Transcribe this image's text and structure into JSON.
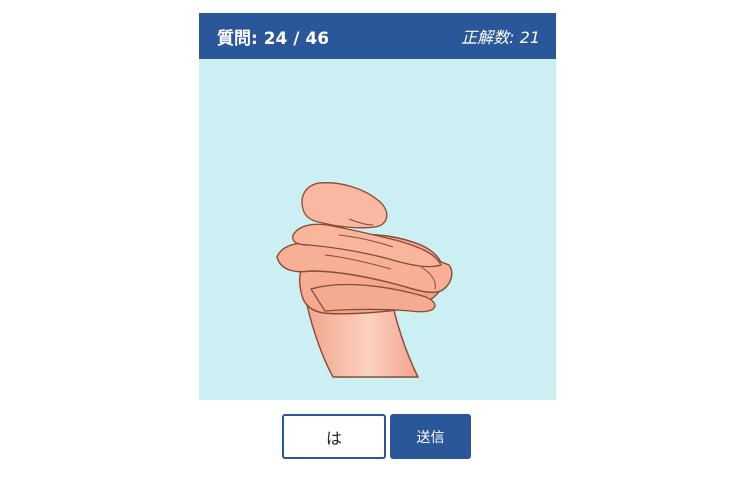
{
  "quiz": {
    "question_counter": "質問: 24 / 46",
    "correct_counter": "正解数: 21",
    "image_subject": "hand-sign-illustration"
  },
  "answer": {
    "value": "は",
    "submit_label": "送信"
  },
  "colors": {
    "header_bg": "#2a579a",
    "image_bg": "#cbeff2",
    "button_bg": "#2a579a",
    "skin": "#f4a98d",
    "skin_outline": "#8a4a35"
  }
}
